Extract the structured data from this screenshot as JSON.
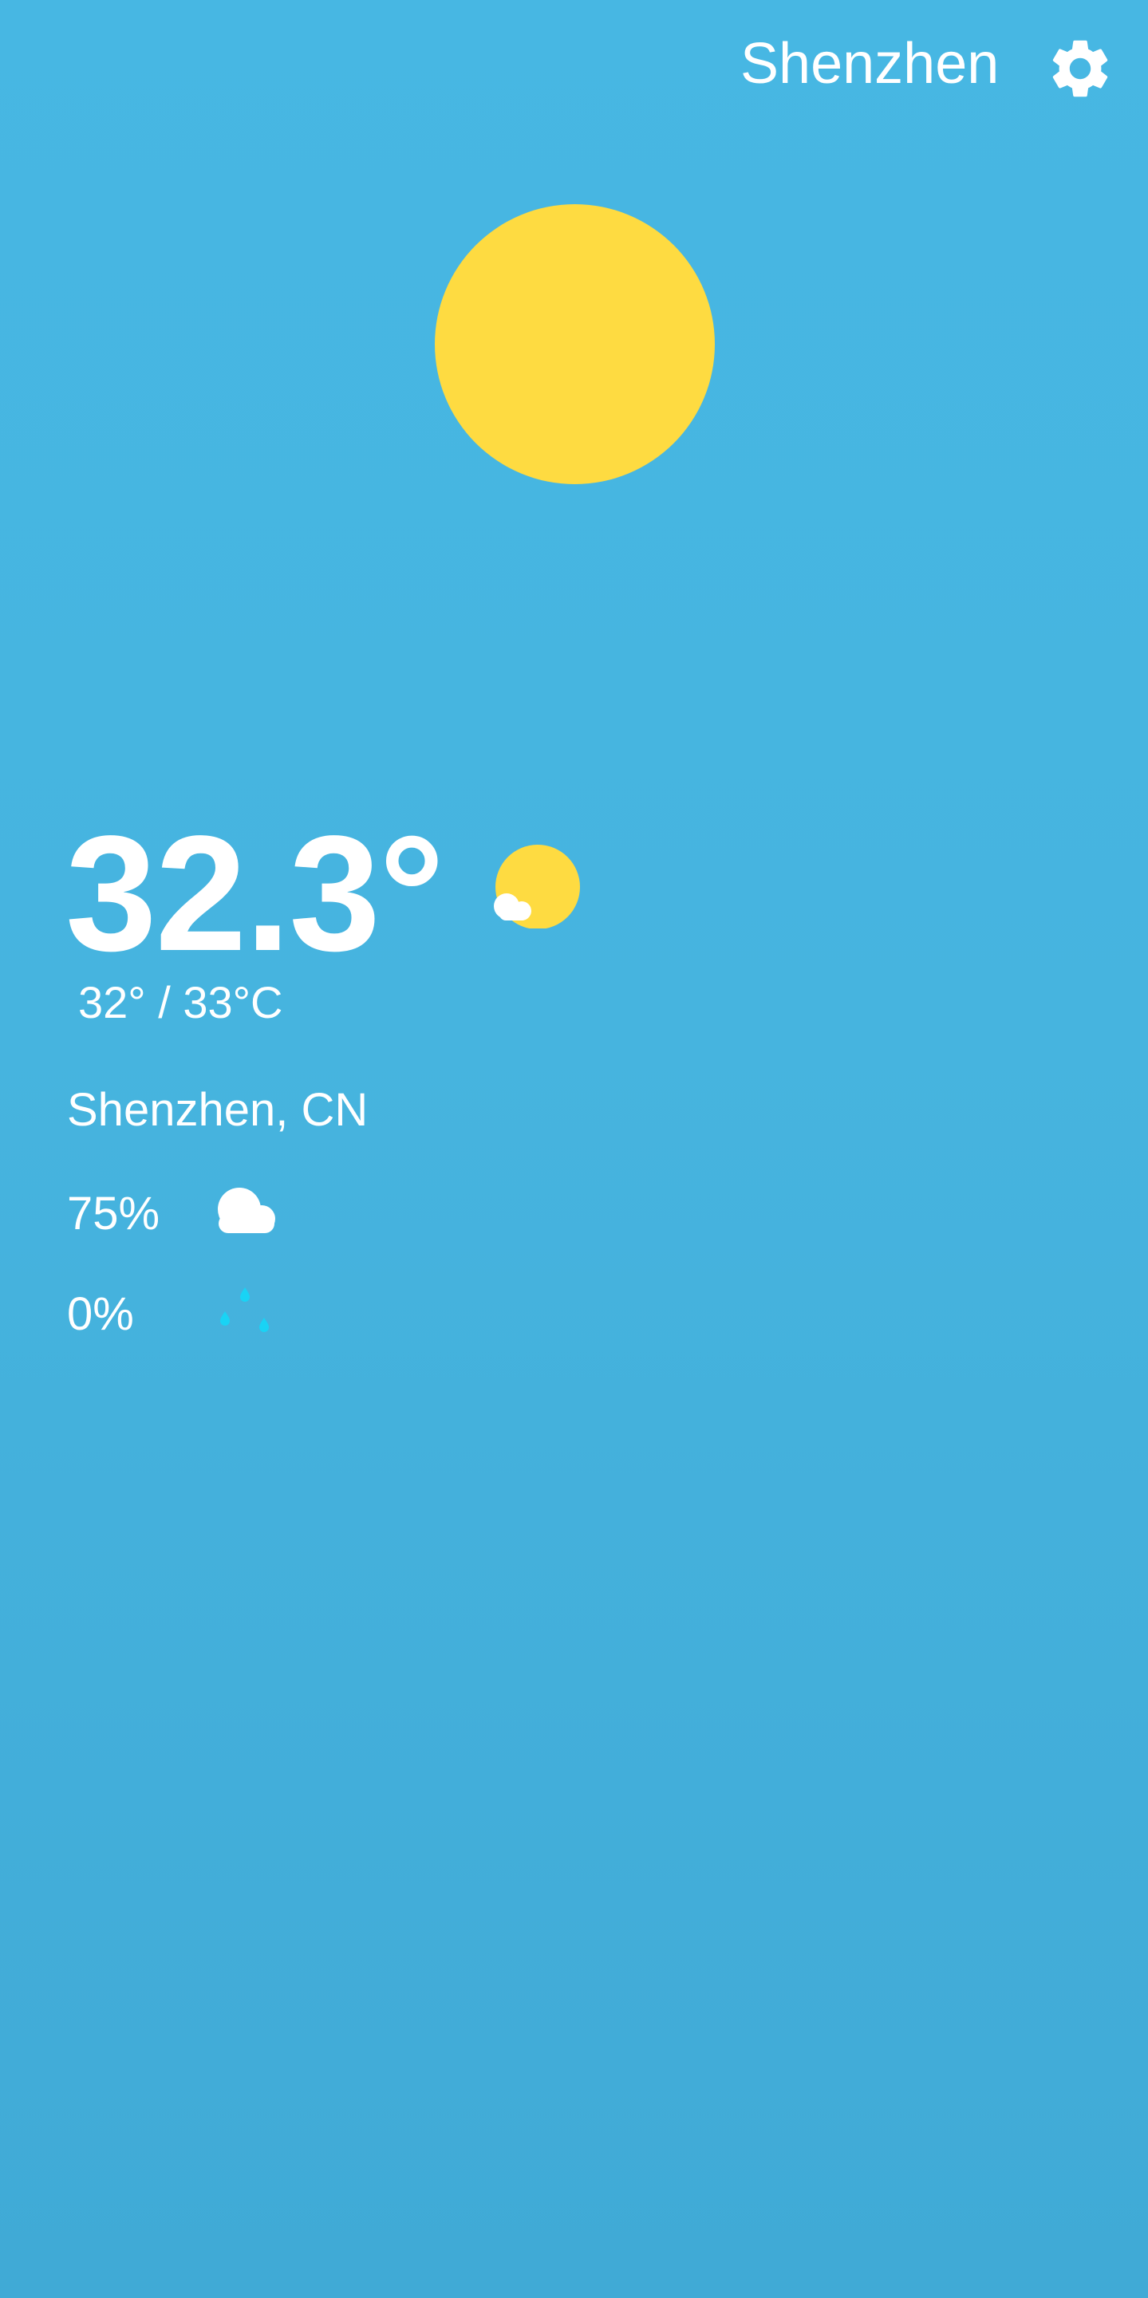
{
  "header": {
    "city": "Shenzhen",
    "settings_icon": "gear-icon"
  },
  "current": {
    "temperature": "32.3°",
    "range": "32° / 33°C",
    "location": "Shenzhen, CN",
    "condition_icon": "sun-with-cloud-icon"
  },
  "stats": {
    "cloudiness": "75%",
    "cloudiness_icon": "cloud-icon",
    "precipitation": "0%",
    "precipitation_icon": "raindrops-icon"
  },
  "colors": {
    "background_top": "#47b7e3",
    "background_bottom": "#40aad6",
    "sun": "#fedb41",
    "text": "#ffffff",
    "raindrop": "#19d3f5"
  }
}
